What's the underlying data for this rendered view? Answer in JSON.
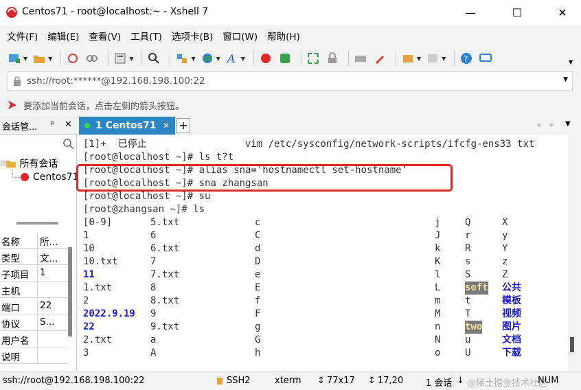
{
  "window": {
    "title": "Centos71 - root@localhost:~ - Xshell 7"
  },
  "menu": [
    "文件(F)",
    "编辑(E)",
    "查看(V)",
    "工具(T)",
    "选项卡(B)",
    "窗口(W)",
    "帮助(H)"
  ],
  "address": {
    "value": "ssh://root:******@192.168.198.100:22"
  },
  "hint": {
    "text": "要添加当前会话，点击左侧的箭头按钮。"
  },
  "session_panel": {
    "title": "会话管...",
    "pin": "ᵖ",
    "close": "✕",
    "tree_root": "所有会话",
    "tree_child": "Centos71",
    "props": [
      {
        "k": "名称",
        "v": "所..."
      },
      {
        "k": "类型",
        "v": "文..."
      },
      {
        "k": "子项目",
        "v": "1"
      },
      {
        "k": "主机",
        "v": ""
      },
      {
        "k": "端口",
        "v": "22"
      },
      {
        "k": "协议",
        "v": "S..."
      },
      {
        "k": "用户名",
        "v": ""
      },
      {
        "k": "说明",
        "v": ""
      }
    ]
  },
  "tab": {
    "label": "1 Centos71",
    "close": "✕",
    "add": "+"
  },
  "terminal": {
    "lines": [
      "[1]+  已停止                 vim /etc/sysconfig/network-scripts/ifcfg-ens33 txt",
      "[root@localhost ~]# ls t?t",
      "[root@localhost ~]# alias sna='hostnamectl set-hostname'",
      "[root@localhost ~]# sna zhangsan",
      "[root@localhost ~]# su",
      "[root@zhangsan ~]# ls"
    ],
    "ls_columns": [
      [
        "[0-9]",
        "1",
        "10",
        "10.txt",
        "11",
        "1.txt",
        "2",
        "2022.9.19",
        "22",
        "2.txt",
        "3"
      ],
      [
        "5.txt",
        "6",
        "6.txt",
        "7",
        "7.txt",
        "8",
        "8.txt",
        "9",
        "9.txt",
        "a",
        "A"
      ],
      [
        "c",
        "C",
        "d",
        "D",
        "e",
        "E",
        "f",
        "F",
        "g",
        "G",
        "h"
      ],
      [
        "j",
        "J",
        "k",
        "K",
        "l",
        "L",
        "m",
        "M",
        "n",
        "N",
        "o"
      ],
      [
        "Q",
        "r",
        "R",
        "s",
        "S",
        "soft",
        "t",
        "T",
        "two",
        "u",
        "U"
      ],
      [
        "X",
        "y",
        "Y",
        "z",
        "Z",
        "公共",
        "模板",
        "视频",
        "图片",
        "文档",
        "下载"
      ]
    ],
    "highlight_color": "#e0262d"
  },
  "status": {
    "connection": "ssh://root@192.168.198.100:22",
    "protocol": "SSH2",
    "terminal_type": "xterm",
    "size": "77x17",
    "cursor": "17,20",
    "sessions": "1 会话",
    "watermark": "@稀土掘金技术社区",
    "numlock": "NUM"
  }
}
